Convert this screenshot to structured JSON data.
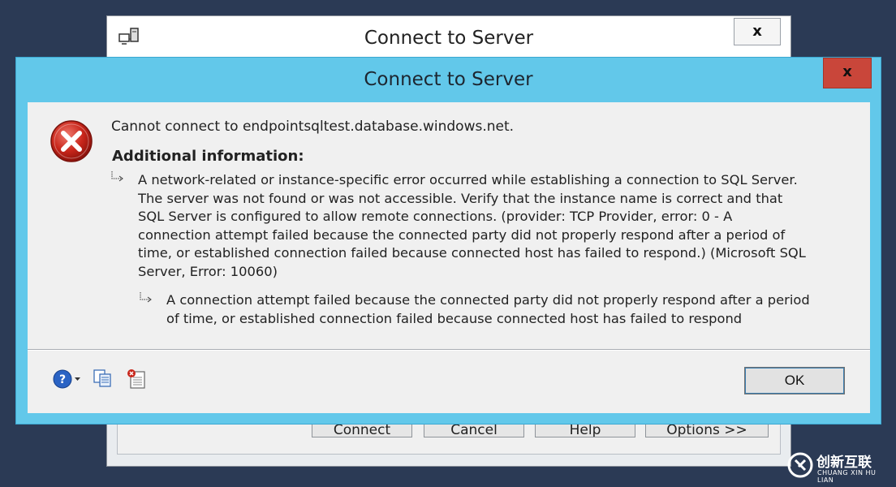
{
  "background_window": {
    "title": "Connect to Server",
    "close_label": "x",
    "buttons": [
      "Connect",
      "Cancel",
      "Help",
      "Options >>"
    ]
  },
  "error_dialog": {
    "title": "Connect to Server",
    "close_label": "x",
    "message": "Cannot connect to endpointsqltest.database.windows.net.",
    "additional_info_heading": "Additional information:",
    "detail": "A network-related or instance-specific error occurred while establishing a connection to SQL Server.\nThe server was not found or was not accessible. Verify that the instance name is correct and that\nSQL Server is configured to allow remote connections. (provider: TCP Provider, error: 0 - A\nconnection attempt failed because the connected party did not properly respond after a period of\ntime, or established connection failed because connected host has failed to respond.) (Microsoft SQL\nServer, Error: 10060)",
    "inner_detail": "A connection attempt failed because the connected party did not properly respond after a period\nof time, or established connection failed because connected host has failed to respond",
    "ok_label": "OK",
    "toolbar_icons": [
      "help-icon",
      "copy-icon",
      "show-details-icon"
    ]
  },
  "watermark": {
    "text": "创新互联",
    "subtext": "CHUANG XIN HU LIAN"
  },
  "colors": {
    "dialog_accent": "#62c8ea",
    "close_button": "#c9463a",
    "desktop": "#2b3a55"
  }
}
